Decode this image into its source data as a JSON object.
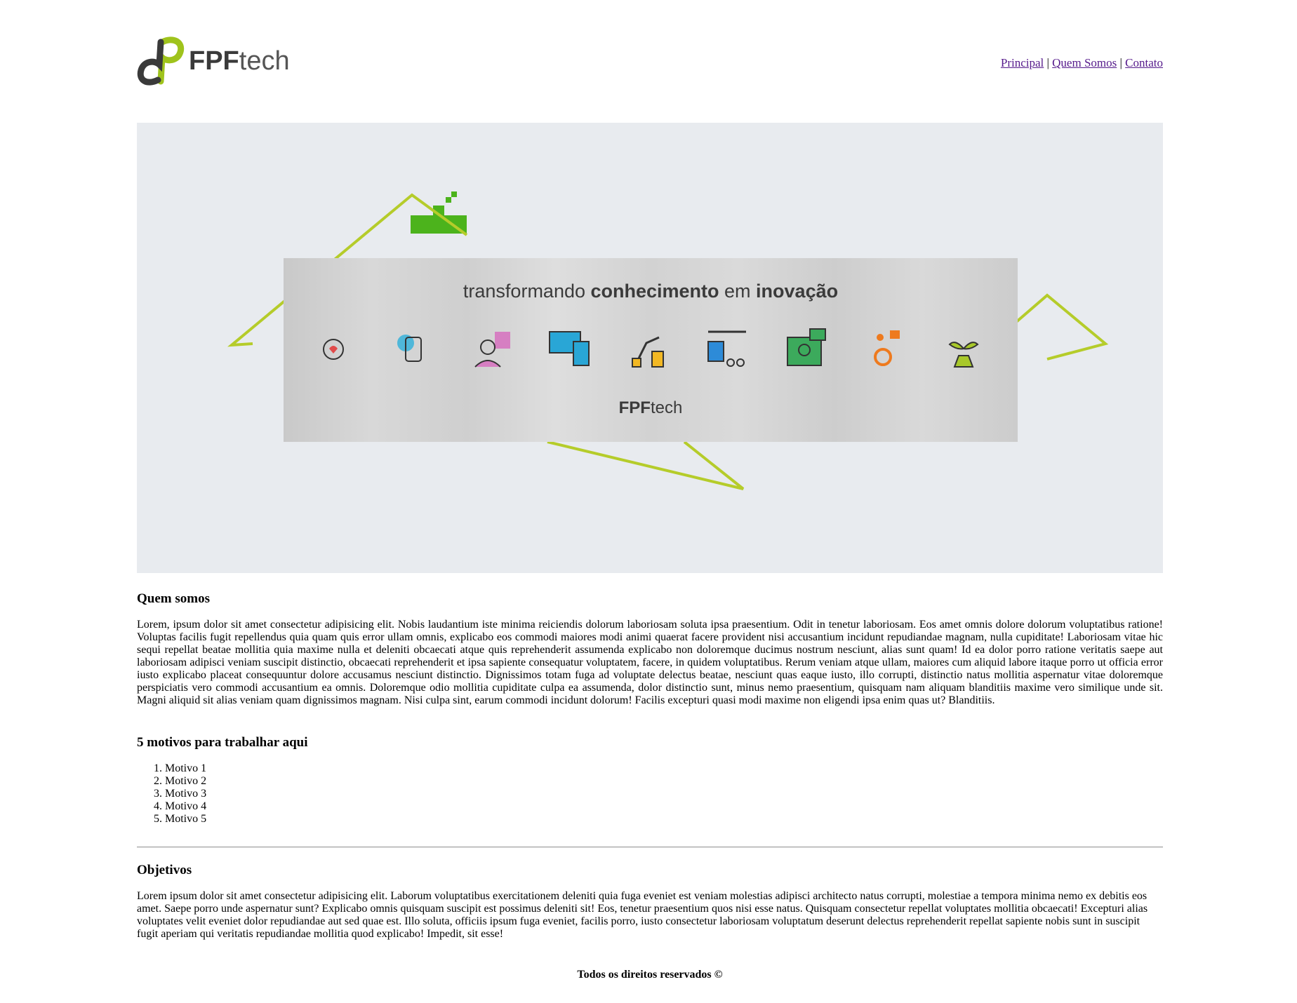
{
  "header": {
    "logo_text_bold": "FPF",
    "logo_text_light": "tech",
    "nav": [
      {
        "label": "Principal"
      },
      {
        "label": "Quem Somos"
      },
      {
        "label": "Contato"
      }
    ],
    "nav_separator": "|"
  },
  "banner": {
    "tagline_1": "transformando ",
    "tagline_2": "conhecimento",
    "tagline_3": " em ",
    "tagline_4": "inovação",
    "logo_bold": "FPF",
    "logo_light": "tech",
    "accent_color": "#b5cc2a",
    "icons": [
      "handshake-heart-icon",
      "smartwatch-icon",
      "doctor-icon",
      "devices-icon",
      "robot-arm-icon",
      "factory-line-icon",
      "online-education-icon",
      "accessibility-icon",
      "plant-flask-icon"
    ]
  },
  "about": {
    "title": "Quem somos",
    "text": "Lorem, ipsum dolor sit amet consectetur adipisicing elit. Nobis laudantium iste minima reiciendis dolorum laboriosam soluta ipsa praesentium. Odit in tenetur laboriosam. Eos amet omnis dolore dolorum voluptatibus ratione! Voluptas facilis fugit repellendus quia quam quis error ullam omnis, explicabo eos commodi maiores modi animi quaerat facere provident nisi accusantium incidunt repudiandae magnam, nulla cupiditate! Laboriosam vitae hic sequi repellat beatae mollitia quia maxime nulla et deleniti obcaecati atque quis reprehenderit assumenda explicabo non doloremque ducimus nostrum nesciunt, alias sunt quam! Id ea dolor porro ratione veritatis saepe aut laboriosam adipisci veniam suscipit distinctio, obcaecati reprehenderit et ipsa sapiente consequatur voluptatem, facere, in quidem voluptatibus. Rerum veniam atque ullam, maiores cum aliquid labore itaque porro ut officia error iusto explicabo placeat consequuntur dolore accusamus nesciunt distinctio. Dignissimos totam fuga ad voluptate delectus beatae, nesciunt quas eaque iusto, illo corrupti, distinctio natus mollitia aspernatur vitae doloremque perspiciatis vero commodi accusantium ea omnis. Doloremque odio mollitia cupiditate culpa ea assumenda, dolor distinctio sunt, minus nemo praesentium, quisquam nam aliquam blanditiis maxime vero similique unde sit. Magni aliquid sit alias veniam quam dignissimos magnam. Nisi culpa sint, earum commodi incidunt dolorum! Facilis excepturi quasi modi maxime non eligendi ipsa enim quas ut? Blanditiis."
  },
  "reasons": {
    "title": "5 motivos para trabalhar aqui",
    "items": [
      "Motivo 1",
      "Motivo 2",
      "Motivo 3",
      "Motivo 4",
      "Motivo 5"
    ]
  },
  "goals": {
    "title": "Objetivos",
    "text": "Lorem ipsum dolor sit amet consectetur adipisicing elit. Laborum voluptatibus exercitationem deleniti quia fuga eveniet est veniam molestias adipisci architecto natus corrupti, molestiae a tempora minima nemo ex debitis eos amet. Saepe porro unde aspernatur sunt? Explicabo omnis quisquam suscipit est possimus deleniti sit! Eos, tenetur praesentium quos nisi esse natus. Quisquam consectetur repellat voluptates mollitia obcaecati! Excepturi alias voluptates velit eveniet dolor repudiandae aut sed quae est. Illo soluta, officiis ipsum fuga eveniet, facilis porro, iusto consectetur laboriosam voluptatum deserunt delectus reprehenderit repellat sapiente nobis sunt in suscipit fugit aperiam qui veritatis repudiandae mollitia quod explicabo! Impedit, sit esse!"
  },
  "footer": {
    "text": "Todos os direitos reservados ©"
  },
  "colors": {
    "link": "#551a8b",
    "banner_bg": "#e8ebef",
    "logo_green": "#9fc31c",
    "logo_dark": "#3a3a3a"
  }
}
